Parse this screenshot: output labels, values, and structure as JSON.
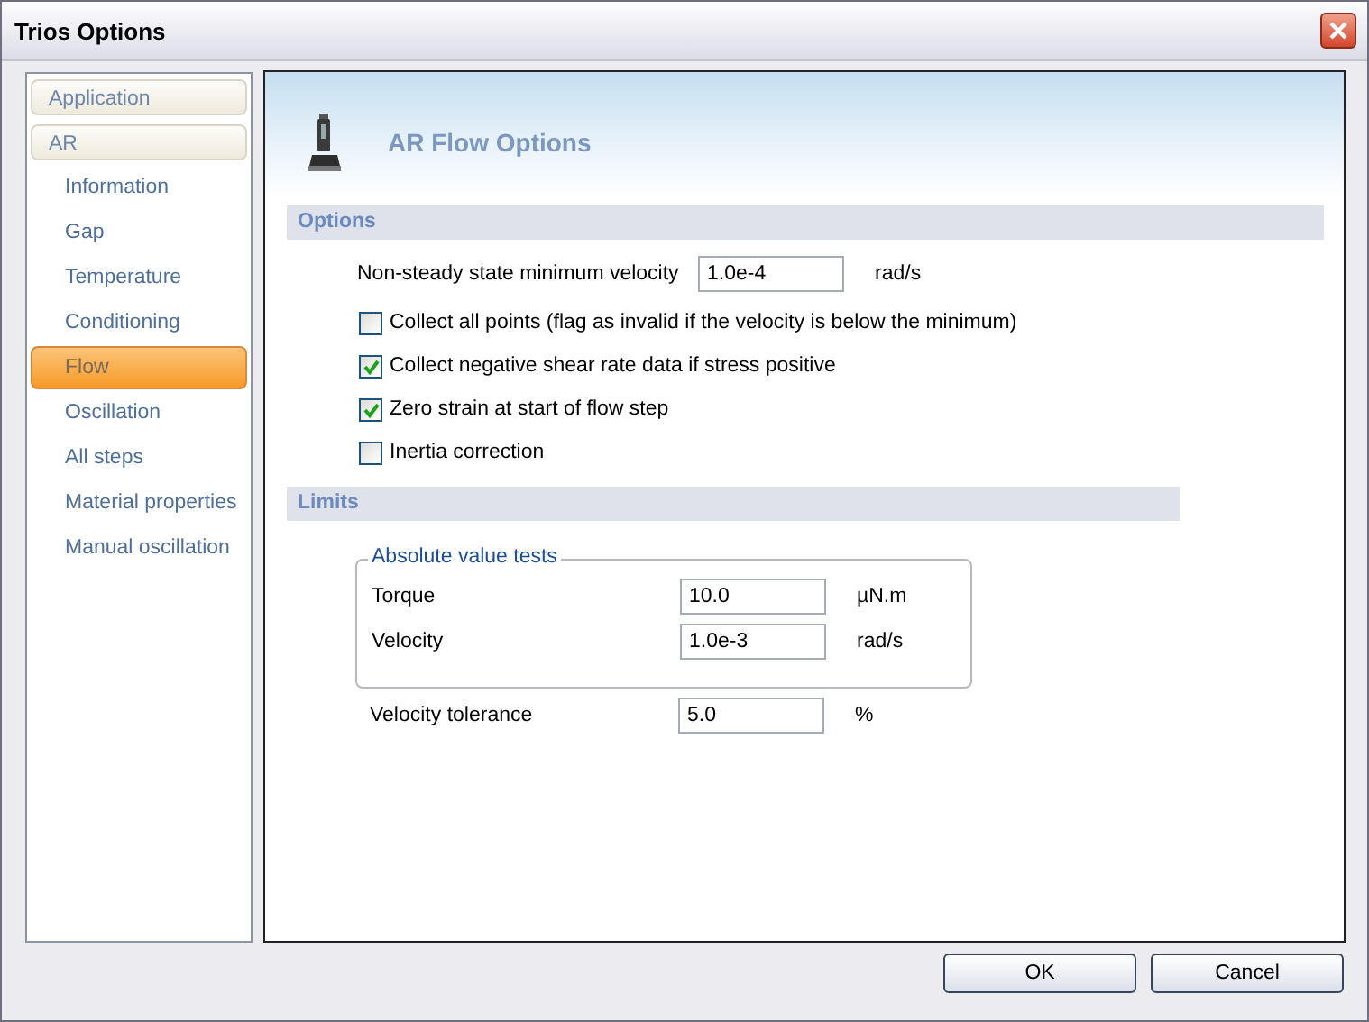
{
  "window": {
    "title": "Trios Options"
  },
  "sidebar": {
    "items": [
      {
        "label": "Application",
        "kind": "group",
        "selected": false
      },
      {
        "label": "AR",
        "kind": "group",
        "selected": false
      },
      {
        "label": "Information",
        "kind": "item",
        "selected": false
      },
      {
        "label": "Gap",
        "kind": "item",
        "selected": false
      },
      {
        "label": "Temperature",
        "kind": "item",
        "selected": false
      },
      {
        "label": "Conditioning",
        "kind": "item",
        "selected": false
      },
      {
        "label": "Flow",
        "kind": "item",
        "selected": true
      },
      {
        "label": "Oscillation",
        "kind": "item",
        "selected": false
      },
      {
        "label": "All steps",
        "kind": "item",
        "selected": false
      },
      {
        "label": "Material properties",
        "kind": "item",
        "selected": false
      },
      {
        "label": "Manual oscillation",
        "kind": "item",
        "selected": false
      }
    ]
  },
  "header": {
    "title": "AR Flow Options"
  },
  "options": {
    "title": "Options",
    "field": {
      "label": "Non-steady state minimum velocity",
      "value": "1.0e-4",
      "unit": "rad/s"
    },
    "checkboxes": [
      {
        "label": "Collect all points (flag as invalid if the velocity is below the minimum)",
        "checked": false
      },
      {
        "label": "Collect negative shear rate data if stress positive",
        "checked": true
      },
      {
        "label": "Zero strain at start of flow step",
        "checked": true
      },
      {
        "label": "Inertia correction",
        "checked": false
      }
    ]
  },
  "limits": {
    "title": "Limits",
    "group": {
      "title": "Absolute value tests",
      "fields": [
        {
          "label": "Torque",
          "value": "10.0",
          "unit": "µN.m"
        },
        {
          "label": "Velocity",
          "value": "1.0e-3",
          "unit": "rad/s"
        }
      ]
    },
    "fields": [
      {
        "label": "Velocity tolerance",
        "value": "5.0",
        "unit": "%"
      }
    ]
  },
  "buttons": [
    {
      "label": "OK"
    },
    {
      "label": "Cancel"
    }
  ]
}
